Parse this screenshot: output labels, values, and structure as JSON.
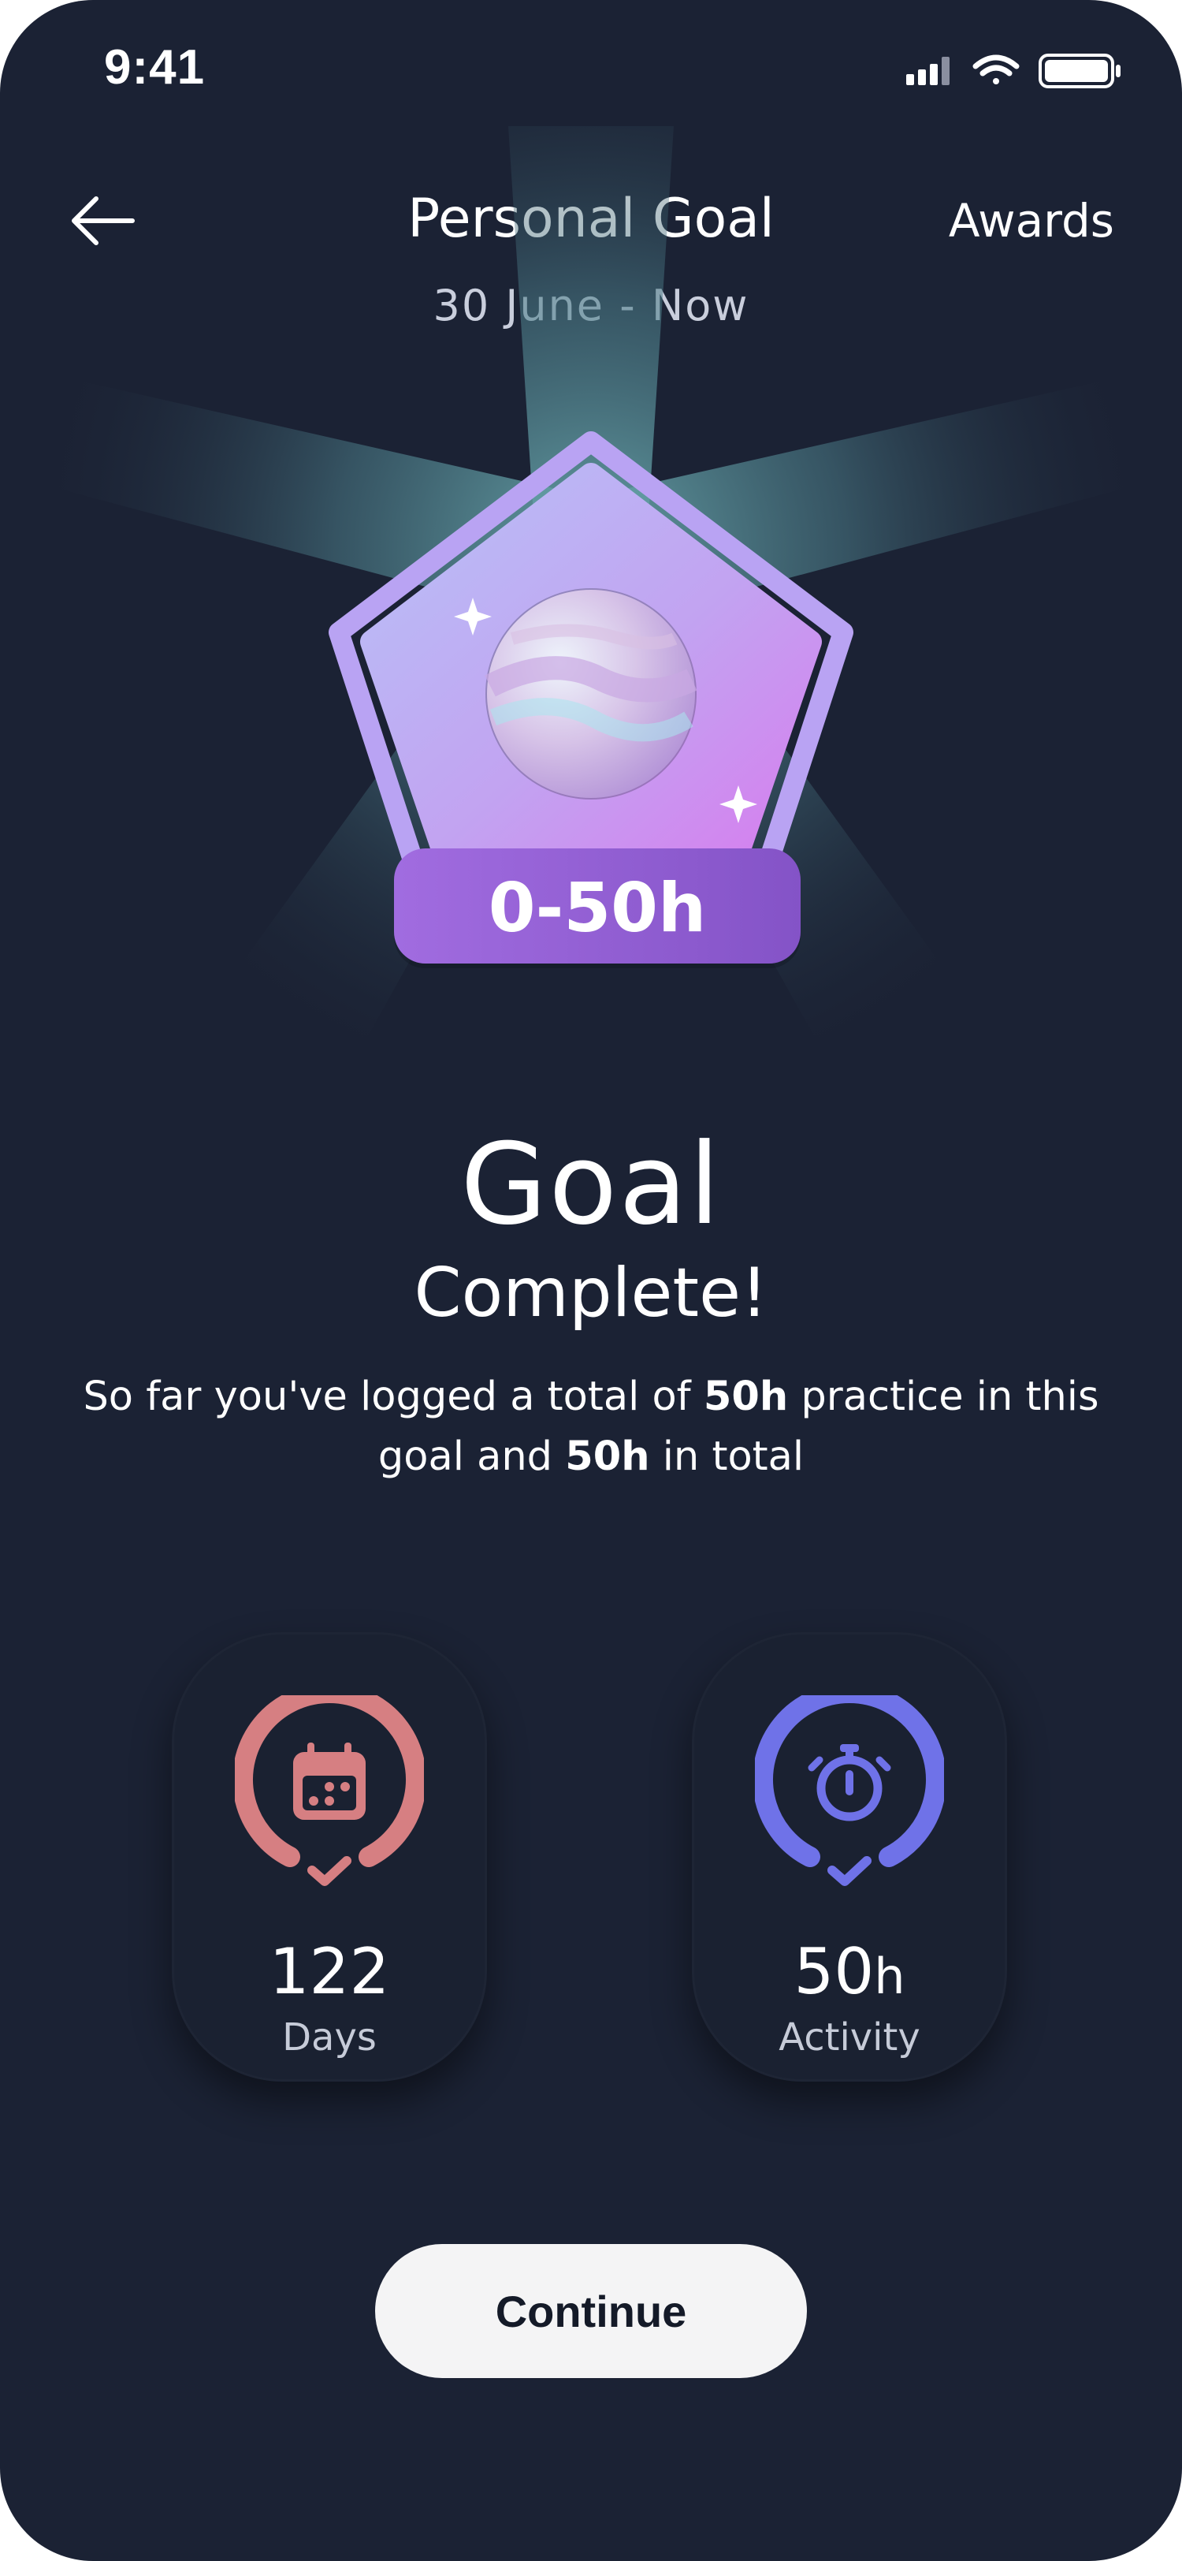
{
  "status_bar": {
    "time": "9:41",
    "icons": [
      "signal-icon",
      "wifi-icon",
      "battery-icon"
    ]
  },
  "header": {
    "back_icon": "arrow-left-icon",
    "title": "Personal Goal",
    "subtitle": "30 June - Now",
    "awards_label": "Awards"
  },
  "badge": {
    "label": "0-50h",
    "icon": "planet-icon",
    "colors": {
      "frame": "#b9a3f3",
      "fill_top": "#c2bbf6",
      "fill_bottom": "#d087f0",
      "ribbon": "#9562d8"
    }
  },
  "goal": {
    "heading": "Goal",
    "subheading": "Complete!",
    "summary_before": "So far you've logged a total of ",
    "summary_bold_1": "50h",
    "summary_middle": " practice in this goal and ",
    "summary_bold_2": "50h",
    "summary_after": " in total"
  },
  "stats": [
    {
      "icon": "calendar-icon",
      "value": "122",
      "unit": "",
      "label": "Days",
      "color": "#d67f82",
      "progress": 1.0
    },
    {
      "icon": "stopwatch-icon",
      "value": "50",
      "unit": "h",
      "label": "Activity",
      "color": "#6f72e8",
      "progress": 1.0
    }
  ],
  "continue_label": "Continue",
  "colors": {
    "background": "#1b2234",
    "glow": "#5f9aa3"
  }
}
